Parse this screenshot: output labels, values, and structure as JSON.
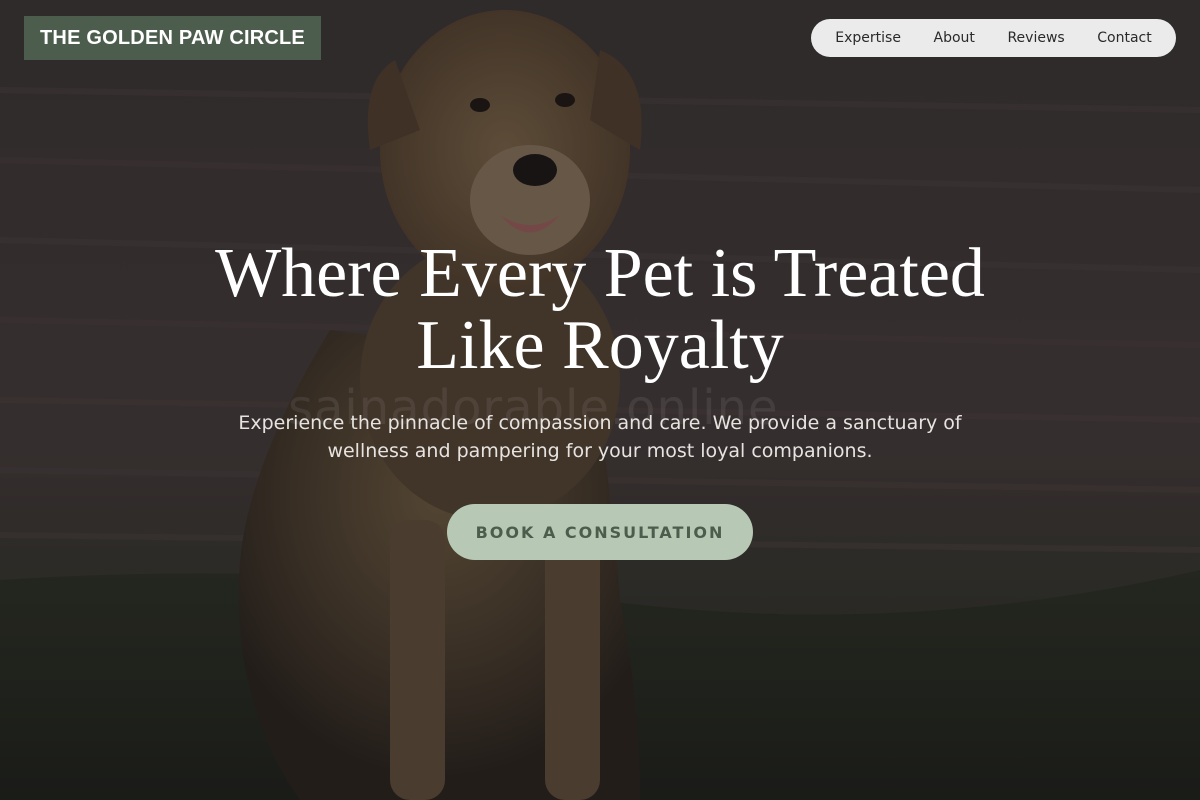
{
  "brand": {
    "name": "THE GOLDEN PAW CIRCLE",
    "color": "#4d5d4d"
  },
  "nav": {
    "items": [
      {
        "label": "Expertise"
      },
      {
        "label": "About"
      },
      {
        "label": "Reviews"
      },
      {
        "label": "Contact"
      }
    ]
  },
  "hero": {
    "headline": "Where Every Pet is Treated Like Royalty",
    "subtitle": "Experience the pinnacle of compassion and care. We provide a sanctuary of wellness and pampering for your most loyal companions.",
    "cta_label": "BOOK A CONSULTATION",
    "cta_color": "#b7c9b4",
    "watermark": "sainadorable.online"
  }
}
